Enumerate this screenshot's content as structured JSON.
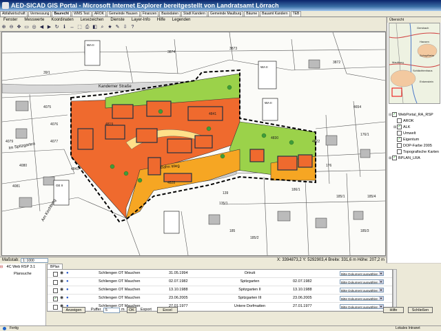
{
  "window": {
    "title": "AED-SICAD GIS Portal - Microsoft Internet Explorer bereitgestellt von Landratsamt Lörrach"
  },
  "app_tabs": [
    {
      "label": "Abfallwirtschaft",
      "active": false
    },
    {
      "label": "Vermessung",
      "active": false
    },
    {
      "label": "Baurecht",
      "active": true
    },
    {
      "label": "WMS Test",
      "active": false
    },
    {
      "label": "AROK",
      "active": false
    },
    {
      "label": "Gemeinde Hausen",
      "active": false
    },
    {
      "label": "Finanzen",
      "active": false
    },
    {
      "label": "Basisdaten",
      "active": false
    },
    {
      "label": "Stadt Kandern",
      "active": false
    },
    {
      "label": "Gemeinde Maulburg",
      "active": false
    },
    {
      "label": "Bäume",
      "active": false
    },
    {
      "label": "Bauamt Kandern",
      "active": false
    },
    {
      "label": "TEB",
      "active": false
    }
  ],
  "menu": [
    "Fenster",
    "Messwerte",
    "Koordinaten",
    "Lesezeichen",
    "Dienste",
    "Layer-Info",
    "Hilfe",
    "Legenden"
  ],
  "toolbar_icons": [
    "zoom-in-icon",
    "zoom-out-icon",
    "pan-icon",
    "zoom-window-icon",
    "full-extent-icon",
    "back-icon",
    "forward-icon",
    "refresh-icon",
    "info-icon",
    "measure-icon",
    "select-icon",
    "print-icon",
    "layer-icon",
    "search-icon",
    "bookmark-icon",
    "redline-icon",
    "export-icon",
    "help-icon"
  ],
  "toolbar_glyphs": [
    "⊕",
    "⊖",
    "✥",
    "▭",
    "◎",
    "◀",
    "▶",
    "↻",
    "ℹ",
    "↔",
    "⬚",
    "⎙",
    "◧",
    "⌕",
    "★",
    "✎",
    "⇩",
    "?"
  ],
  "map": {
    "street_labels": [
      "Kanderner Straße",
      "Im Spitzgarten",
      "Am Kirchberg",
      "Bahn Weg"
    ],
    "parcel_numbers": [
      "3874",
      "3873",
      "39/1",
      "3872",
      "4654",
      "4075",
      "4076",
      "4077",
      "4079",
      "4080",
      "4081",
      "4819",
      "4841",
      "4828",
      "4830",
      "4822",
      "139",
      "135/1",
      "176",
      "176/1",
      "185",
      "185/2",
      "186/1",
      "185/1",
      "185/3",
      "185/4",
      "4843"
    ],
    "zone_labels": [
      "WA II",
      "WA II",
      "WA II",
      "GE II"
    ]
  },
  "scale": {
    "label": "Maßstab:",
    "value": "1: 1000"
  },
  "coord_readout": "X: 3394873,2 Y: 5292903,4 Breite: 331,6 m Höhe: 207,2 m",
  "overview": {
    "label": "Übersicht",
    "place_labels": [
      "Gersbach",
      "Hausen",
      "Schopfheim",
      "Maulburg",
      "Schlächtenhaus",
      "Enkenstein"
    ]
  },
  "layers": [
    {
      "label": "WebPortal_RA_RSP",
      "indent": 0,
      "checked": true,
      "expand": "⊟"
    },
    {
      "label": "AROK",
      "indent": 1,
      "checked": false,
      "expand": ""
    },
    {
      "label": "ALK",
      "indent": 1,
      "checked": true,
      "expand": "⊞"
    },
    {
      "label": "Umwelt",
      "indent": 1,
      "checked": false,
      "expand": ""
    },
    {
      "label": "Eigentum",
      "indent": 1,
      "checked": true,
      "expand": ""
    },
    {
      "label": "DOP-Farbe 2005",
      "indent": 1,
      "checked": false,
      "expand": ""
    },
    {
      "label": "Topografische Karten",
      "indent": 1,
      "checked": false,
      "expand": ""
    },
    {
      "label": "BPLAN_LRA",
      "indent": 0,
      "checked": true,
      "expand": "⊞"
    }
  ],
  "bookmarks": {
    "label": "4C Web RSP 3.1",
    "sub": "Plansuche"
  },
  "bottom_tab": "BPlan",
  "plans": [
    {
      "location": "Schliengen OT Mauchen",
      "date": "31.05.1994",
      "name": "Ortrutt",
      "date2": "",
      "checked": false,
      "select": "Bitte Dokument auswählen"
    },
    {
      "location": "Schliengen OT Mauchen",
      "date": "02.07.1982",
      "name": "Spitzgarten",
      "date2": "02.07.1982",
      "checked": false,
      "select": "Bitte Dokument auswählen"
    },
    {
      "location": "Schliengen OT Mauchen",
      "date": "13.10.1988",
      "name": "Spitzgarten II",
      "date2": "13.10.1988",
      "checked": false,
      "select": "Bitte Dokument auswählen"
    },
    {
      "location": "Schliengen OT Mauchen",
      "date": "23.06.2005",
      "name": "Spitzgarten III",
      "date2": "23.06.2005",
      "checked": true,
      "select": "Bitte Dokument auswählen"
    },
    {
      "location": "Schliengen OT Mauchen",
      "date": "27.01.1977",
      "name": "Untere Dorfmatten",
      "date2": "27.01.1977",
      "checked": false,
      "select": "Bitte Dokument auswählen"
    },
    {
      "location": "Schliengen OT Mauchen",
      "date": "",
      "name": "Untere Dorfmatten",
      "date2": "",
      "checked": false,
      "select": "Bitte Dokument auswählen"
    }
  ],
  "controls": {
    "show": "Anzeigen",
    "buffer_label": "Puffer",
    "buffer_value": "5",
    "unit": "m",
    "ok": "OK",
    "export_label": "Export",
    "excel": "Excel",
    "help": "Hilfe",
    "close": "Schließen"
  },
  "status": {
    "left": "Fertig",
    "right": "Lokales Intranet"
  },
  "colors": {
    "orange_zone": "#ef6a2e",
    "green_zone": "#9bd24a",
    "yellow_zone": "#f6a623",
    "title_bar": "#0a246a"
  }
}
